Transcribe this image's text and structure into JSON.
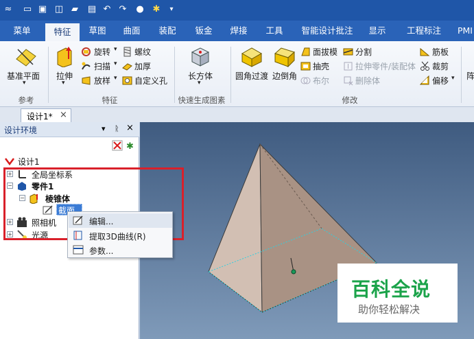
{
  "menubar": {
    "items": [
      "菜单",
      "特征",
      "草图",
      "曲面",
      "装配",
      "钣金",
      "焊接",
      "工具",
      "智能设计批注",
      "显示",
      "工程标注",
      "PMI"
    ]
  },
  "ribbon": {
    "ref_plane": "基准平面",
    "extrude": "拉伸",
    "revolve": "旋转",
    "sweep": "扫描",
    "loft": "放样",
    "thread": "螺纹",
    "thicken": "加厚",
    "custom_hole": "自定义孔",
    "box": "长方体",
    "fillet": "圆角过渡",
    "chamfer": "边倒角",
    "draft": "面拔模",
    "shell": "抽壳",
    "boolean": "布尔",
    "split": "分割",
    "extrude_to_part": "拉伸零件/装配体",
    "delete_body": "删除体",
    "rib": "筋板",
    "trim": "裁剪",
    "offset": "偏移",
    "array": "阵",
    "groups": {
      "reference": "参考",
      "feature": "特征",
      "quick": "快速生成图素",
      "modify": "修改"
    }
  },
  "doc_tab": {
    "label": "设计1*",
    "close": "×"
  },
  "panel": {
    "title": "设计环境",
    "buttons": {
      "pin": "▾",
      "dock": "ᚱ",
      "close": "×"
    }
  },
  "tree": {
    "root": "设计1",
    "global_coords": "全局坐标系",
    "part": "零件1",
    "feature": "棱锥体",
    "section": "截面",
    "camera": "照相机",
    "light": "光源"
  },
  "context_menu": {
    "items": [
      "编辑...",
      "提取3D曲线(R)",
      "参数..."
    ]
  },
  "watermark": {
    "title": "百科全说",
    "subtitle": "助你轻松解决"
  },
  "colors": {
    "accent": "#2a63b8",
    "highlight": "#d9202a",
    "watermark_title": "#1ba34a"
  }
}
